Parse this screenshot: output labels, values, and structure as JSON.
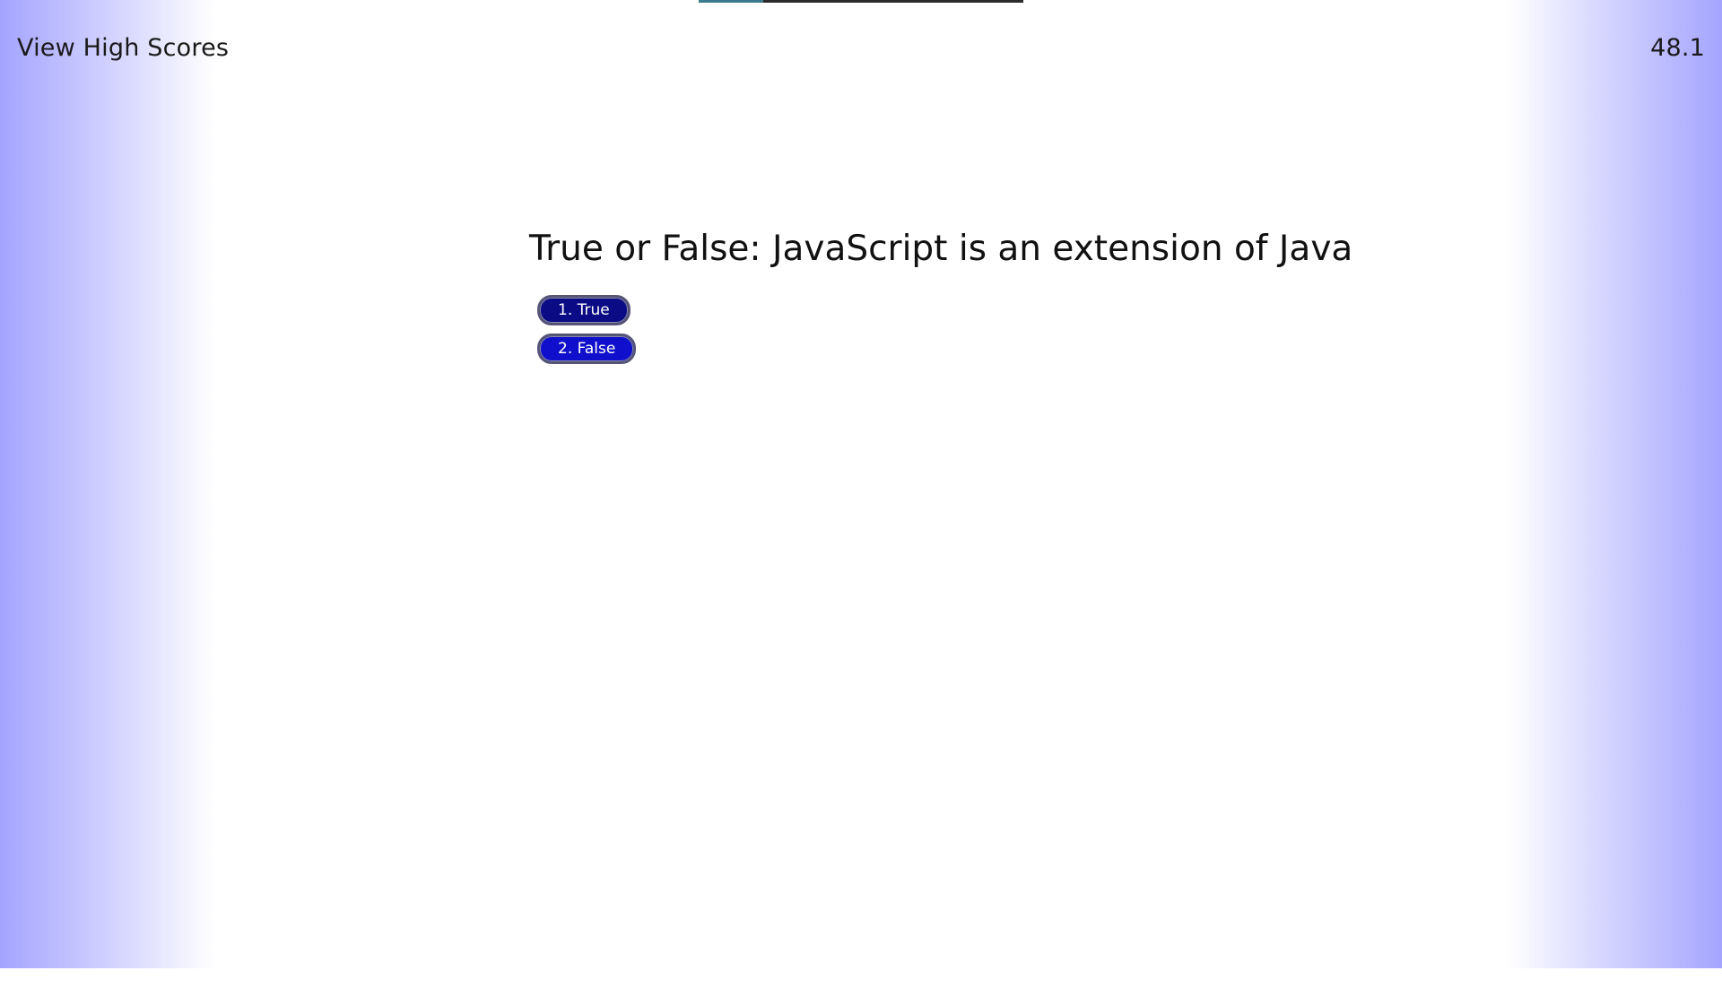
{
  "header": {
    "high_scores_label": "View High Scores",
    "timer_value": "48.1"
  },
  "progress": {
    "fraction": 0.2
  },
  "quiz": {
    "question": "True or False: JavaScript is an extension of Java",
    "answers": [
      {
        "label": "1. True"
      },
      {
        "label": "2. False"
      }
    ]
  },
  "colors": {
    "side_gradient": "#a4a4ff",
    "answer_button_dark": "#0b0b86",
    "answer_button_bright": "#1010cc",
    "progress_fill": "#3a7a8c",
    "progress_track": "#2b2b2b"
  }
}
